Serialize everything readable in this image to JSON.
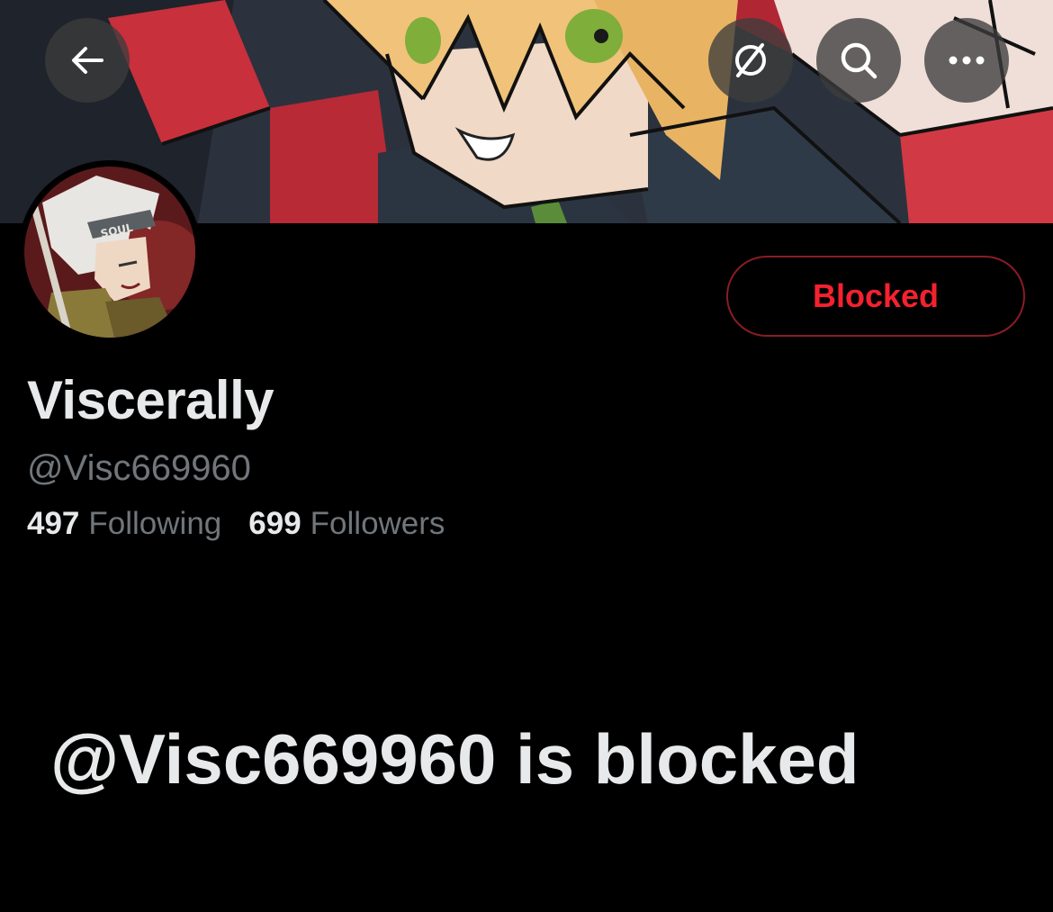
{
  "header": {
    "back_icon": "arrow-left-icon",
    "actions": [
      {
        "icon": "bell-slash-icon"
      },
      {
        "icon": "search-icon"
      },
      {
        "icon": "more-horizontal-icon"
      }
    ]
  },
  "profile": {
    "display_name": "Viscerally",
    "handle": "@Visc669960",
    "blocked_button_label": "Blocked",
    "following_count": "497",
    "following_label": "Following",
    "followers_count": "699",
    "followers_label": "Followers",
    "avatar_badge_text": "SOUL"
  },
  "blocked_notice": {
    "message": "@Visc669960 is blocked"
  },
  "colors": {
    "background": "#000000",
    "primary_text": "#e7e9ea",
    "secondary_text": "#71767b",
    "danger": "#f4212e",
    "danger_border": "#8a1c24"
  }
}
